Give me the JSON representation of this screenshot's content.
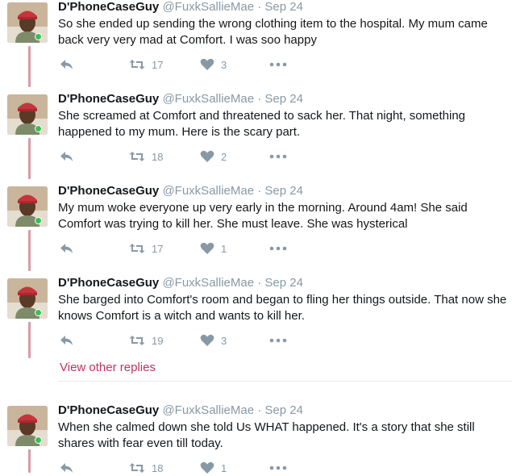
{
  "tweets": [
    {
      "name": "D'PhoneCaseGuy",
      "handle": "@FuxkSallieMae",
      "separator": "·",
      "date": "Sep 24",
      "text": "So she ended up sending the wrong clothing item to the hospital.  My mum came back very very mad at Comfort. I was soo happy",
      "retweets": "17",
      "likes": "3"
    },
    {
      "name": "D'PhoneCaseGuy",
      "handle": "@FuxkSallieMae",
      "separator": "·",
      "date": "Sep 24",
      "text": "She screamed at Comfort and threatened to sack her. That night, something happened to my mum. Here is the scary part.",
      "retweets": "18",
      "likes": "2"
    },
    {
      "name": "D'PhoneCaseGuy",
      "handle": "@FuxkSallieMae",
      "separator": "·",
      "date": "Sep 24",
      "text": "My mum woke everyone up very early in the morning. Around 4am! She said Comfort was trying to kill her. She must leave.  She was hysterical",
      "retweets": "17",
      "likes": "1"
    },
    {
      "name": "D'PhoneCaseGuy",
      "handle": "@FuxkSallieMae",
      "separator": "·",
      "date": "Sep 24",
      "text": "She barged into Comfort's room and began to fling her things outside.  That now she knows Comfort is a witch and wants to kill her.",
      "retweets": "19",
      "likes": "3"
    },
    {
      "name": "D'PhoneCaseGuy",
      "handle": "@FuxkSallieMae",
      "separator": "·",
      "date": "Sep 24",
      "text": "When she calmed down she told Us WHAT happened. It's a story that she still shares with fear even till today.",
      "retweets": "18",
      "likes": "1"
    }
  ],
  "view_other_replies": "View other replies",
  "icons": {
    "reply": "reply-icon",
    "retweet": "retweet-icon",
    "like": "heart-icon",
    "more": "more-icon"
  },
  "colors": {
    "thread_line": "#d89aaa",
    "link": "#c0335d",
    "muted": "#8899a6"
  }
}
